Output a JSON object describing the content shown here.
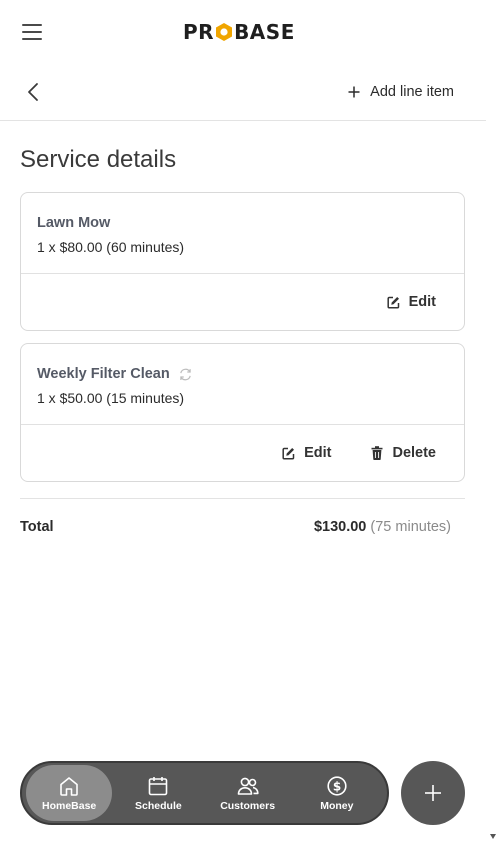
{
  "header": {
    "logo_text": "PROBASE",
    "logo_pre": "PR",
    "logo_post": "BASE"
  },
  "subheader": {
    "add_line_item_label": "Add line item"
  },
  "main": {
    "title": "Service details",
    "line_items": [
      {
        "name": "Lawn Mow",
        "detail": "1 x $80.00 (60 minutes)",
        "recurring": false,
        "actions": {
          "edit": "Edit"
        }
      },
      {
        "name": "Weekly Filter Clean",
        "detail": "1 x $50.00 (15 minutes)",
        "recurring": true,
        "actions": {
          "edit": "Edit",
          "delete": "Delete"
        }
      }
    ],
    "total": {
      "label": "Total",
      "amount": "$130.00",
      "duration": "(75 minutes)"
    }
  },
  "bottom_nav": {
    "items": [
      {
        "label": "HomeBase",
        "icon": "home-icon",
        "active": true
      },
      {
        "label": "Schedule",
        "icon": "calendar-icon",
        "active": false
      },
      {
        "label": "Customers",
        "icon": "users-icon",
        "active": false
      },
      {
        "label": "Money",
        "icon": "dollar-icon",
        "active": false
      }
    ]
  },
  "colors": {
    "nav_background": "#575757",
    "nav_active": "#8c8c8c",
    "logo_accent": "#f0a500",
    "text_primary": "#2b2b2b",
    "item_name": "#555a66"
  }
}
